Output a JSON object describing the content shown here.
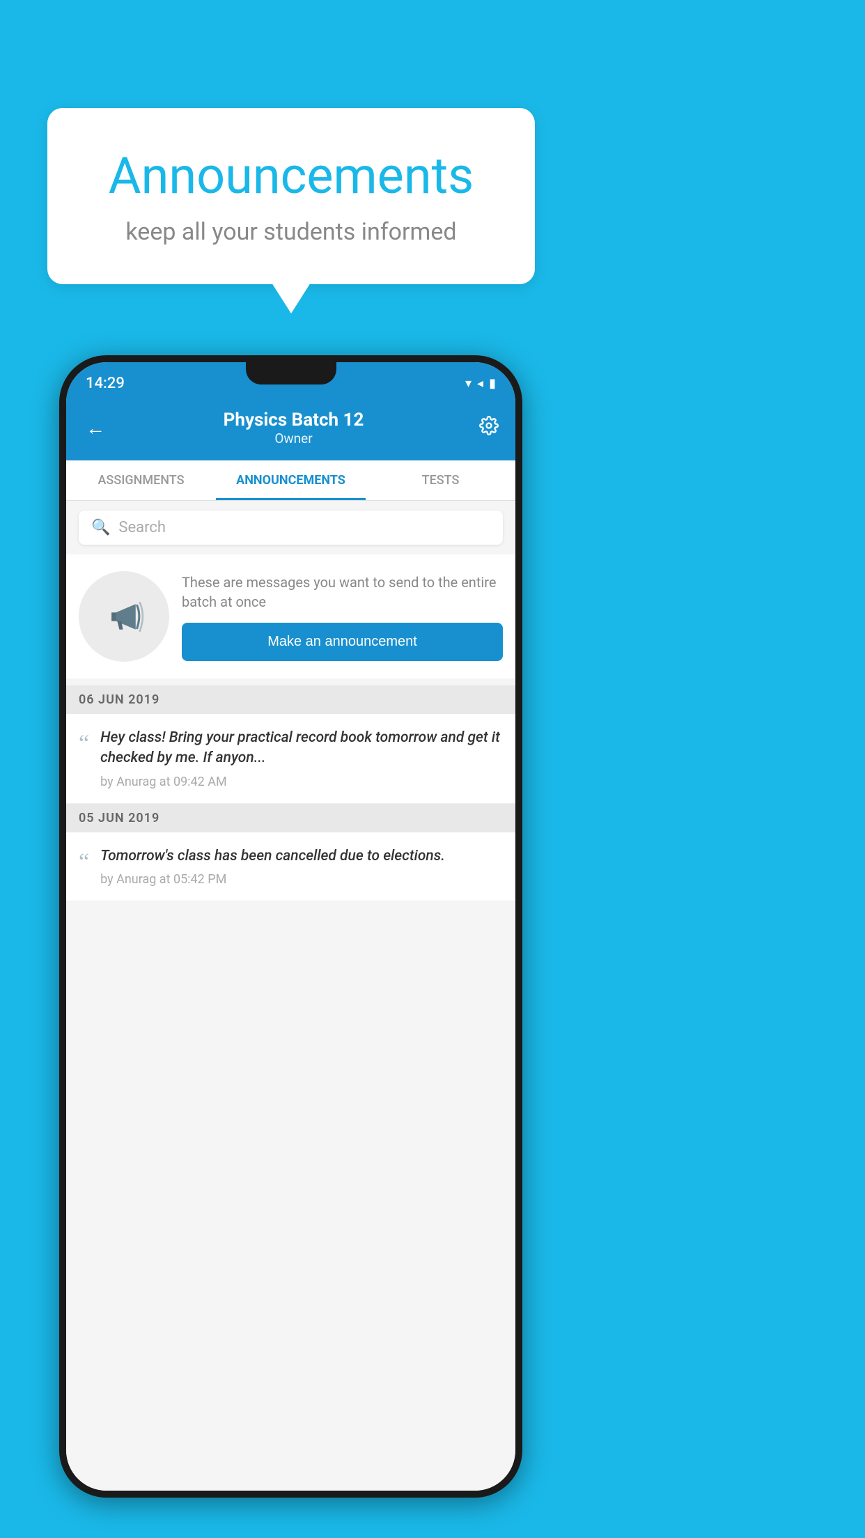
{
  "background_color": "#1ab8e8",
  "speech_bubble": {
    "title": "Announcements",
    "subtitle": "keep all your students informed"
  },
  "phone": {
    "status_bar": {
      "time": "14:29",
      "icons": "▾◂▮"
    },
    "header": {
      "back_label": "←",
      "title": "Physics Batch 12",
      "subtitle": "Owner",
      "settings_label": "⚙"
    },
    "tabs": [
      {
        "label": "ASSIGNMENTS",
        "active": false
      },
      {
        "label": "ANNOUNCEMENTS",
        "active": true
      },
      {
        "label": "TESTS",
        "active": false
      }
    ],
    "search": {
      "placeholder": "Search"
    },
    "promo": {
      "description": "These are messages you want to send to the entire batch at once",
      "button_label": "Make an announcement"
    },
    "announcements": [
      {
        "date": "06  JUN  2019",
        "text": "Hey class! Bring your practical record book tomorrow and get it checked by me. If anyon...",
        "meta": "by Anurag at 09:42 AM"
      },
      {
        "date": "05  JUN  2019",
        "text": "Tomorrow's class has been cancelled due to elections.",
        "meta": "by Anurag at 05:42 PM"
      }
    ]
  }
}
